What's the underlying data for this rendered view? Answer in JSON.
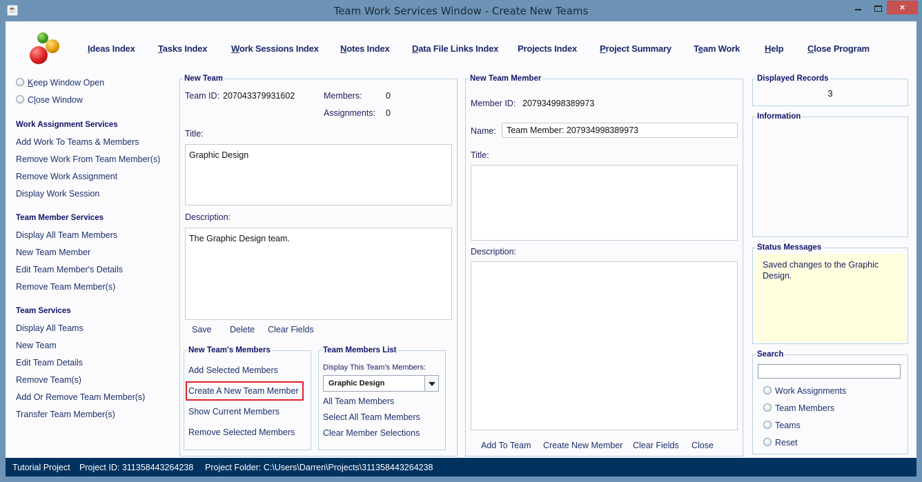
{
  "window": {
    "title": "Team Work Services Window - Create New Teams",
    "icon": "java-cup-icon",
    "controls": {
      "minimize": "minimize-icon",
      "maximize": "maximize-icon",
      "close": "×"
    }
  },
  "topnav": {
    "items": [
      {
        "label": "Ideas Index",
        "mnemonic": "I"
      },
      {
        "label": "Tasks Index",
        "mnemonic": "T"
      },
      {
        "label": "Work Sessions Index",
        "mnemonic": "W"
      },
      {
        "label": "Notes Index",
        "mnemonic": "N"
      },
      {
        "label": "Data File Links Index",
        "mnemonic": "D"
      },
      {
        "label": "Projects Index",
        "mnemonic": ""
      },
      {
        "label": "Project Summary",
        "mnemonic": "P"
      },
      {
        "label": "Team Work",
        "mnemonic": "e"
      },
      {
        "label": "Help",
        "mnemonic": "H"
      },
      {
        "label": "Close Program",
        "mnemonic": "C"
      }
    ]
  },
  "sidebar": {
    "radios": [
      {
        "label": "Keep Window Open",
        "mnemonic": "K"
      },
      {
        "label": "Close Window",
        "mnemonic": "l"
      }
    ],
    "sections": [
      {
        "heading": "Work Assignment Services",
        "items": [
          "Add Work To Teams & Members",
          "Remove Work From Team Member(s)",
          "Remove Work Assignment",
          "Display Work Session"
        ]
      },
      {
        "heading": "Team Member Services",
        "items": [
          "Display All Team Members",
          "New Team Member",
          "Edit Team Member's Details",
          "Remove Team Member(s)"
        ]
      },
      {
        "heading": "Team Services",
        "items": [
          "Display All Teams",
          "New Team",
          "Edit Team Details",
          "Remove Team(s)",
          "Add Or Remove Team Member(s)",
          "Transfer Team Member(s)"
        ]
      }
    ]
  },
  "new_team": {
    "legend": "New Team",
    "team_id_label": "Team ID:",
    "team_id": "207043379931602",
    "members_label": "Members:",
    "members": "0",
    "assignments_label": "Assignments:",
    "assignments": "0",
    "title_label": "Title:",
    "title_value": "Graphic Design",
    "description_label": "Description:",
    "description_value": "The Graphic Design team.",
    "buttons": {
      "save": "Save",
      "delete": "Delete",
      "clear": "Clear Fields"
    }
  },
  "team_members_box": {
    "legend": "New Team's Members",
    "actions": [
      "Add Selected Members",
      "Create A New Team Member",
      "Show Current Members",
      "Remove Selected Members"
    ],
    "highlighted_index": 1,
    "highlight_color": "#e0202a"
  },
  "members_list": {
    "legend": "Team Members List",
    "display_label": "Display This Team's Members:",
    "selected_team": "Graphic Design",
    "actions": [
      "All Team Members",
      "Select All Team Members",
      "Clear Member Selections"
    ]
  },
  "new_member": {
    "legend": "New Team Member",
    "member_id_label": "Member ID:",
    "member_id": "207934998389973",
    "name_label": "Name:",
    "name_value": "Team Member: 207934998389973",
    "title_label": "Title:",
    "title_value": "",
    "description_label": "Description:",
    "description_value": "",
    "buttons": {
      "add_to_team": "Add To Team",
      "create_new": "Create New Member",
      "clear": "Clear Fields",
      "close": "Close"
    }
  },
  "right_panel": {
    "displayed_records_legend": "Displayed Records",
    "displayed_records": "3",
    "information_legend": "Information",
    "information_text": "",
    "status_legend": "Status Messages",
    "status_text": "Saved changes to the Graphic Design.",
    "search_legend": "Search",
    "search_value": "",
    "search_options": [
      "Work Assignments",
      "Team Members",
      "Teams",
      "Reset"
    ]
  },
  "statusbar": {
    "project_name": "Tutorial Project",
    "project_id": "Project ID:  311358443264238",
    "project_folder": "Project Folder: C:\\Users\\Darren\\Projects\\311358443264238"
  }
}
